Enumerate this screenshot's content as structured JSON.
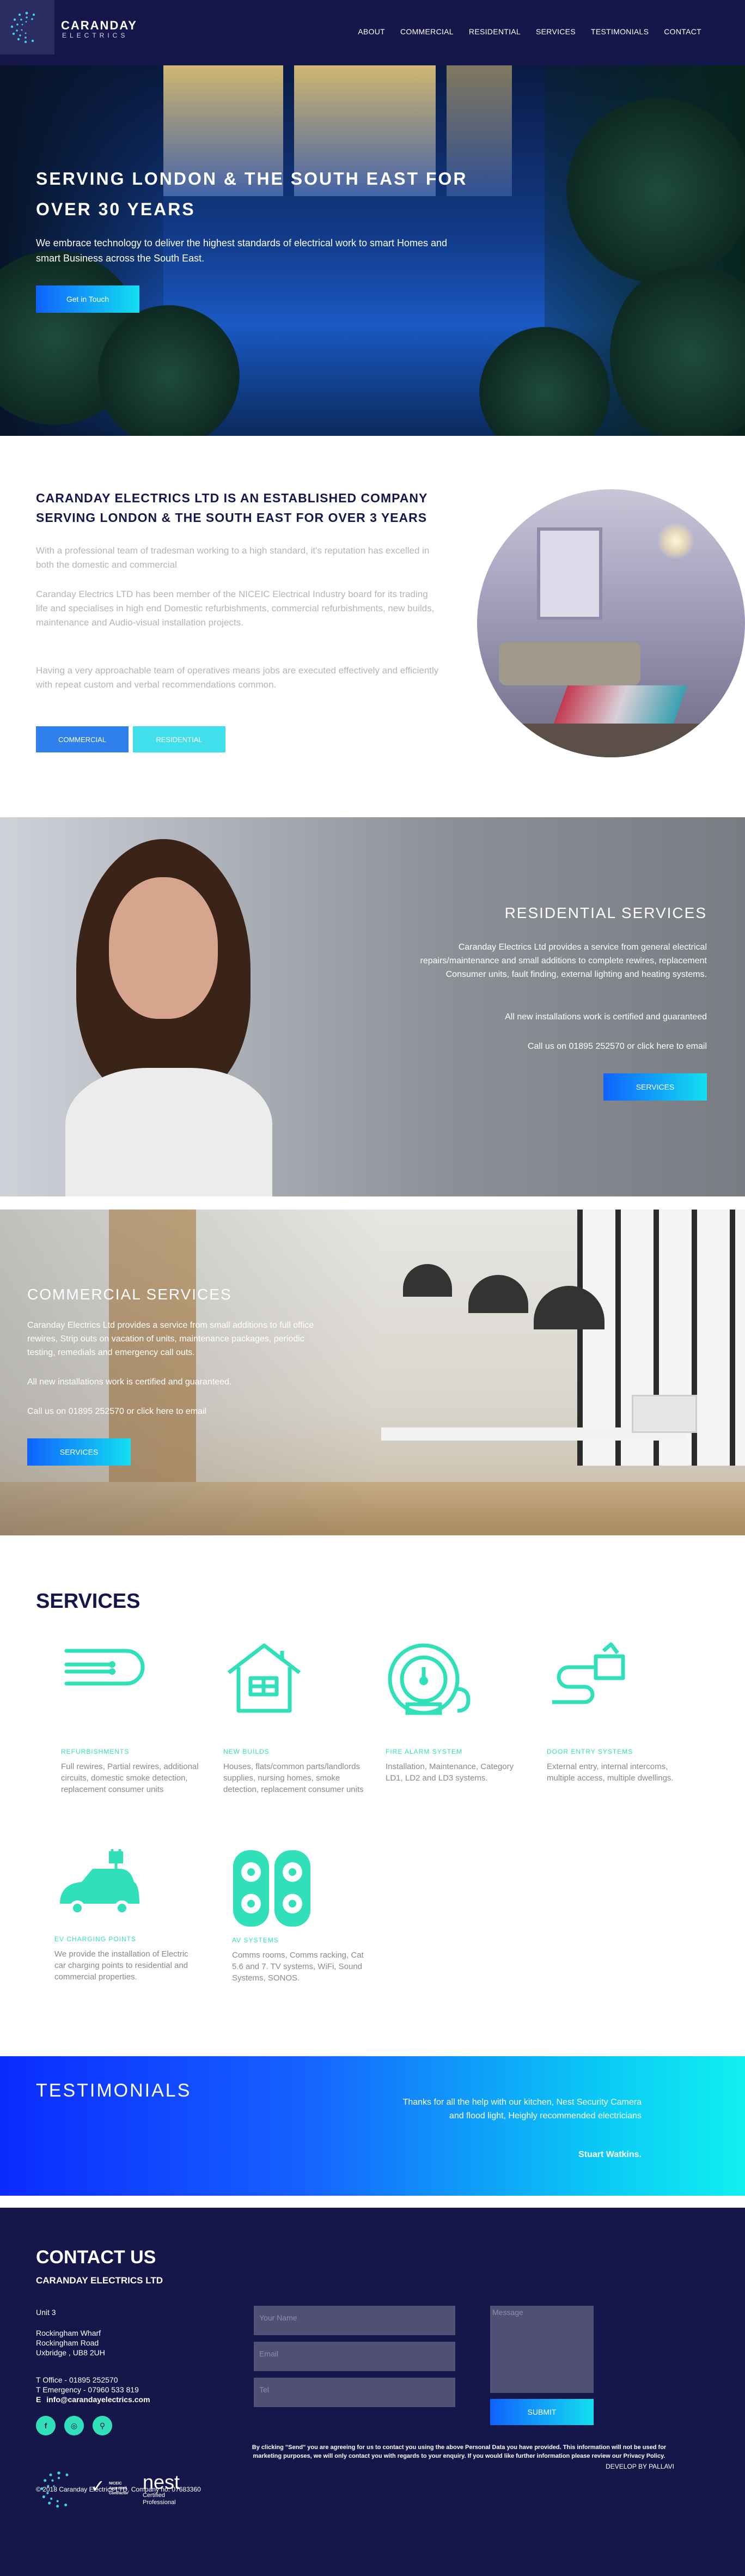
{
  "brand": {
    "name": "CARANDAY",
    "sub": "ELECTRICS"
  },
  "nav": [
    "ABOUT",
    "COMMERCIAL",
    "RESIDENTIAL",
    "SERVICES",
    "TESTIMONIALS",
    "CONTACT"
  ],
  "hero": {
    "title": "SERVING LONDON & THE SOUTH EAST FOR OVER 30 YEARS",
    "text": "We embrace technology to deliver the highest standards of electrical work to smart Homes and smart Business across the South East.",
    "button": "Get in Touch"
  },
  "about": {
    "title": "CARANDAY ELECTRICS LTD IS AN ESTABLISHED COMPANY SERVING LONDON & THE SOUTH EAST FOR OVER 3 YEARS",
    "p1": "With a professional team of tradesman working to a high standard, it's reputation has excelled in both the domestic and commercial",
    "p2": "Caranday Electrics LTD has been member of the NICEIC Electrical Industry board for its trading life and specialises in high end Domestic refurbishments, commercial refurbishments, new builds, maintenance and Audio-visual installation projects.",
    "p3": "Having a very approachable team of operatives means jobs are executed effectively and efficiently with repeat custom and verbal recommendations common.",
    "btn_commercial": "COMMERCIAL",
    "btn_residential": "RESIDENTIAL"
  },
  "residential": {
    "title": "RESIDENTIAL SERVICES",
    "p1": "Caranday Electrics Ltd provides a service from general electrical repairs/maintenance and small additions to complete rewires, replacement Consumer units, fault finding, external lighting and heating systems.",
    "p2": "All new installations work is certified and guaranteed",
    "p3": "Call us on 01895 252570 or click here to email",
    "button": "SERVICES"
  },
  "commercial": {
    "title": "COMMERCIAL SERVICES",
    "p1": "Caranday Electrics Ltd provides a service from small additions to full office rewires, Strip outs on vacation of units, maintenance packages, periodic testing, remedials and emergency call outs.",
    "p2": "All new installations work is certified and guaranteed.",
    "p3": "Call us on 01895 252570 or click here to email",
    "button": "SERVICES"
  },
  "services": {
    "title": "SERVICES",
    "items": [
      {
        "icon": "power-plug-icon",
        "title": "REFURBISHMENTS",
        "text": "Full rewires, Partial rewires, additional circuits, domestic smoke detection, replacement consumer units"
      },
      {
        "icon": "house-icon",
        "title": "NEW BUILDS",
        "text": "Houses, flats/common parts/landlords supplies, nursing homes, smoke detection, replacement consumer units"
      },
      {
        "icon": "fire-alarm-bell-icon",
        "title": "FIRE ALARM SYSTEM",
        "text": "Installation, Maintenance, Category LD1, LD2 and LD3 systems."
      },
      {
        "icon": "door-entry-icon",
        "title": "DOOR ENTRY SYSTEMS",
        "text": "External entry, internal intercoms, multiple access, multiple dwellings."
      },
      {
        "icon": "ev-car-charging-icon",
        "title": "EV CHARGING POINTS",
        "text": "We provide the installation of Electric car charging points to residential and commercial properties."
      },
      {
        "icon": "speakers-icon",
        "title": "AV SYSTEMS",
        "text": "Comms rooms, Comms racking, Cat 5.6 and 7. TV systems, WiFi, Sound Systems, SONOS."
      }
    ]
  },
  "testimonials": {
    "title": "TESTIMONIALS",
    "quote": "Thanks for all the help with our kitchen, Nest Security Camera and flood light, Heighly recommended electricians",
    "author": "Stuart Watkins."
  },
  "contact": {
    "title": "CONTACT US",
    "company": "CARANDAY ELECTRICS LTD",
    "address": [
      "Unit 3",
      "Rockingham Wharf",
      "Rockingham Road",
      "Uxbridge , UB8 2UH"
    ],
    "phone_office": "T Office - 01895 252570",
    "phone_emergency": "T Emergency - 07960 533 819",
    "email_label": "E",
    "email": "info@carandayelectrics.com",
    "placeholders": {
      "name": "Your Name",
      "email": "Email",
      "tel": "Tel",
      "message": "Message"
    },
    "submit": "SUBMIT",
    "consent": "By clicking \"Send\" you are agreeing for us to contact you using the above Personal Data you have provided. This information will not be used for marketing purposes, we will only contact you with regards to your enquiry. If you would like further information please review our Privacy Policy."
  },
  "footer": {
    "badge_text": "NICEIC Approved Contractor",
    "nest": "nest",
    "nest_sub": "Certified Professional",
    "copyright": "© 2018 Caranday Electrics LTD. Company no. 07683360",
    "developer": "DEVELOP BY PALLAVI"
  },
  "colors": {
    "navy": "#15174a",
    "accent_blue": "#0f62ff",
    "accent_cyan": "#13e0f0",
    "mint": "#2fe0b8"
  }
}
